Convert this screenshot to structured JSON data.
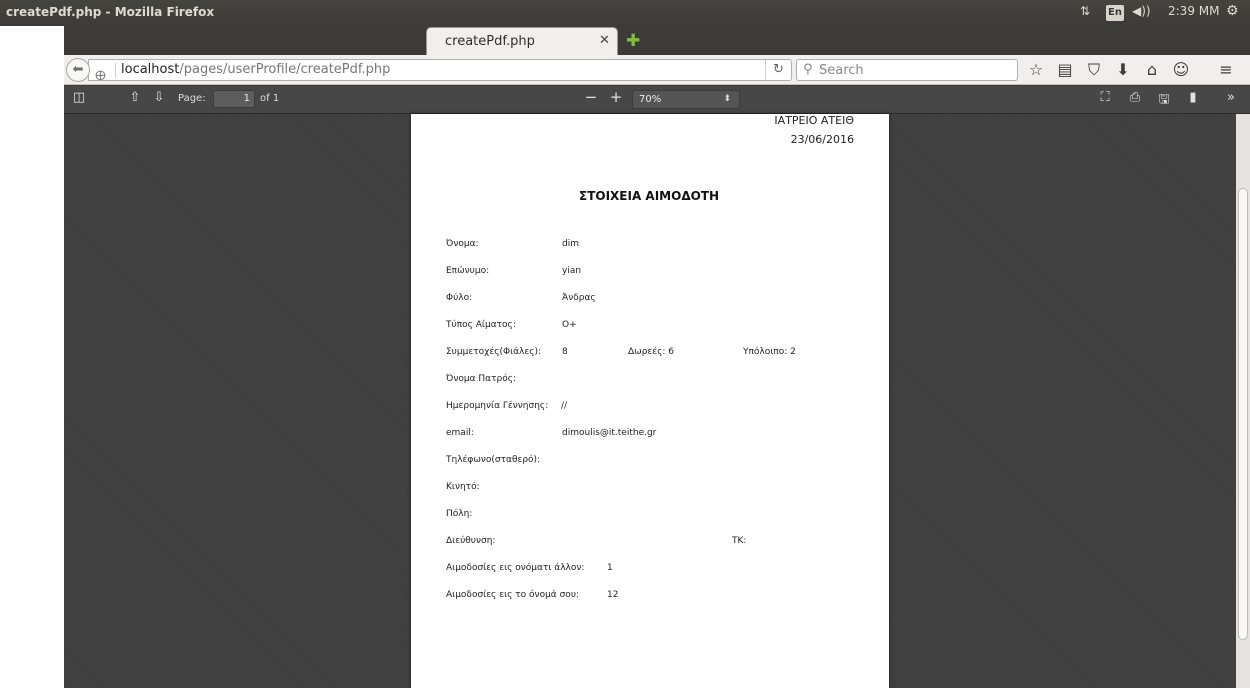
{
  "os": {
    "window_title": "createPdf.php - Mozilla Firefox",
    "lang": "En",
    "volume_icon": "◀))",
    "time": "2:39 ΜΜ"
  },
  "browser": {
    "tab_title": "createPdf.php",
    "url_host": "localhost",
    "url_path": "/pages/userProfile/createPdf.php",
    "search_placeholder": "Search"
  },
  "pdf_toolbar": {
    "page_label": "Page:",
    "page_value": "1",
    "page_of": "of 1",
    "zoom": "70%"
  },
  "document": {
    "header_line1": "ΙΑΤΡΕΙΟ ΑΤΕΙΘ",
    "header_line2": "23/06/2016",
    "title": "ΣΤΟΙΧΕΙΑ ΑΙΜΟΔΟΤΗ",
    "fields": [
      {
        "label": "Όνομα:",
        "value": "dim"
      },
      {
        "label": "Επώνυμο:",
        "value": "yian"
      },
      {
        "label": "Φύλο:",
        "value": "Άνδρας"
      },
      {
        "label": "Τύπος Αίματος:",
        "value": "O+"
      },
      {
        "label": "Συμμετοχές(Φιάλες):",
        "value": "8",
        "extra1": "Δωρεές: 6",
        "extra2": "Υπόλοιπο: 2"
      },
      {
        "label": "Όνομα Πατρός:",
        "value": ""
      },
      {
        "label": "Ημερομηνία Γέννησης:",
        "value": "//"
      },
      {
        "label": "email:",
        "value": "dimoulis@it.teithe.gr"
      },
      {
        "label": "Τηλέφωνο(σταθερό):",
        "value": ""
      },
      {
        "label": "Κινητό:",
        "value": ""
      },
      {
        "label": "Πόλη:",
        "value": ""
      },
      {
        "label": "Διεύθυνση:",
        "value": "",
        "extra": "ΤΚ:"
      },
      {
        "label": "Αιμοδοσίες εις ονόματι άλλον:",
        "value": "1"
      },
      {
        "label": "Αιμοδοσίες εις το όνομά σου:",
        "value": "12"
      }
    ]
  }
}
